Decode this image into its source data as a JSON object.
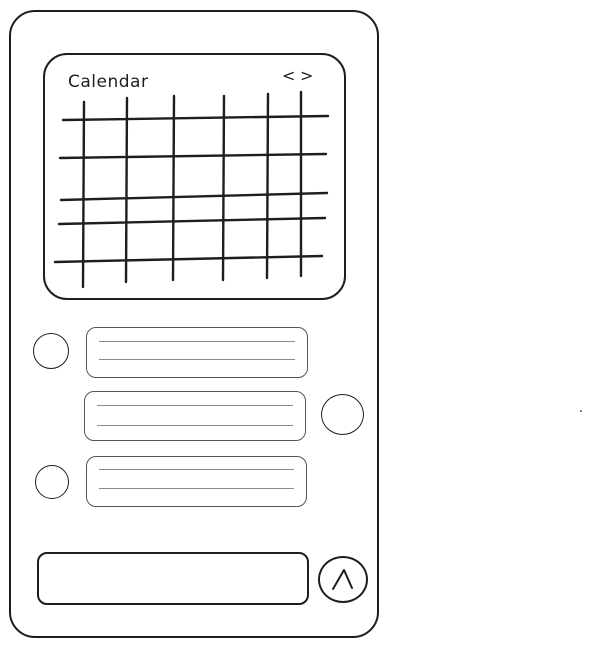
{
  "calendar": {
    "title": "Calendar",
    "prev_label": "<",
    "next_label": ">"
  },
  "messages": {
    "items": [
      {
        "side": "left",
        "lines": 2
      },
      {
        "side": "right",
        "lines": 2
      },
      {
        "side": "left",
        "lines": 2
      }
    ]
  },
  "composer": {
    "send_icon": "send-arrow-icon"
  },
  "colors": {
    "stroke": "#1e1e1e",
    "bubble_stroke": "#555555",
    "text_line": "#8a8a8a",
    "background": "#ffffff"
  }
}
